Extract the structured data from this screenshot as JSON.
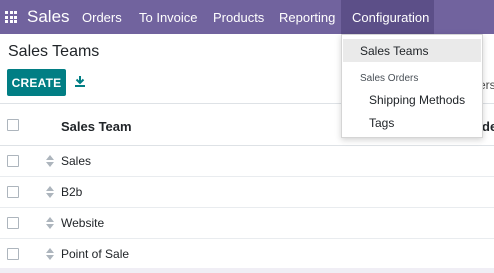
{
  "navbar": {
    "brand": "Sales",
    "menus": [
      "Orders",
      "To Invoice",
      "Products",
      "Reporting",
      "Configuration"
    ]
  },
  "breadcrumb": "Sales Teams",
  "create_label": "CREATE",
  "filters_peek": "ers",
  "table": {
    "header": "Sales Team",
    "header_peek": "de",
    "rows": [
      "Sales",
      "B2b",
      "Website",
      "Point of Sale"
    ]
  },
  "dropdown": {
    "item_sales_teams": "Sales Teams",
    "section_header": "Sales Orders",
    "item_shipping": "Shipping Methods",
    "item_tags": "Tags"
  },
  "colors": {
    "navbar": "#71639e",
    "create_button": "#017e84",
    "download_icon": "#017e84"
  }
}
